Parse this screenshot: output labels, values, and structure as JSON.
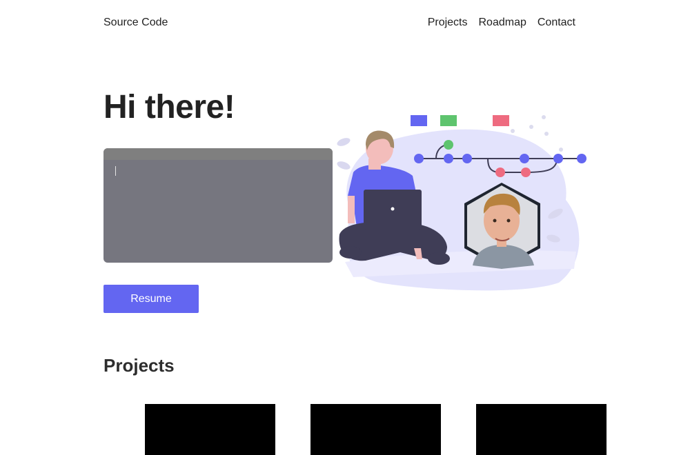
{
  "header": {
    "logo": "Source Code",
    "nav": [
      {
        "label": "Projects"
      },
      {
        "label": "Roadmap"
      },
      {
        "label": "Contact"
      }
    ]
  },
  "hero": {
    "title": "Hi there!",
    "resume_label": "Resume"
  },
  "projects": {
    "title": "Projects",
    "cards": [
      "",
      "",
      ""
    ]
  },
  "colors": {
    "accent": "#6366f1",
    "terminal": "#76767f",
    "green": "#5ec46e",
    "pink": "#ee6b80"
  }
}
